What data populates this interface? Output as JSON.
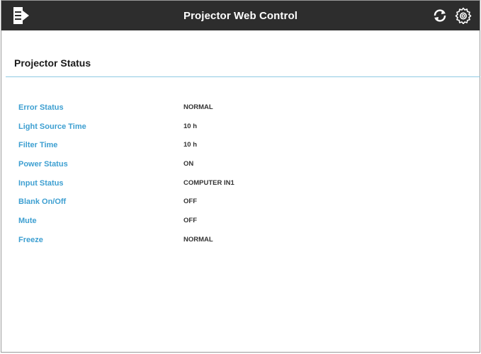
{
  "header": {
    "title": "Projector Web Control",
    "menu_icon": "menu-icon",
    "refresh_icon": "refresh-icon",
    "settings_icon": "gear-icon"
  },
  "section": {
    "title": "Projector Status"
  },
  "status_rows": [
    {
      "label": "Error Status",
      "value": "NORMAL"
    },
    {
      "label": "Light Source Time",
      "value": "10 h"
    },
    {
      "label": "Filter Time",
      "value": "10 h"
    },
    {
      "label": "Power Status",
      "value": "ON"
    },
    {
      "label": "Input Status",
      "value": "COMPUTER IN1"
    },
    {
      "label": "Blank On/Off",
      "value": "OFF"
    },
    {
      "label": "Mute",
      "value": "OFF"
    },
    {
      "label": "Freeze",
      "value": "NORMAL"
    }
  ],
  "colors": {
    "header_bg": "#2d2d2d",
    "label": "#3d9fd1",
    "rule": "#8fc9e3"
  }
}
